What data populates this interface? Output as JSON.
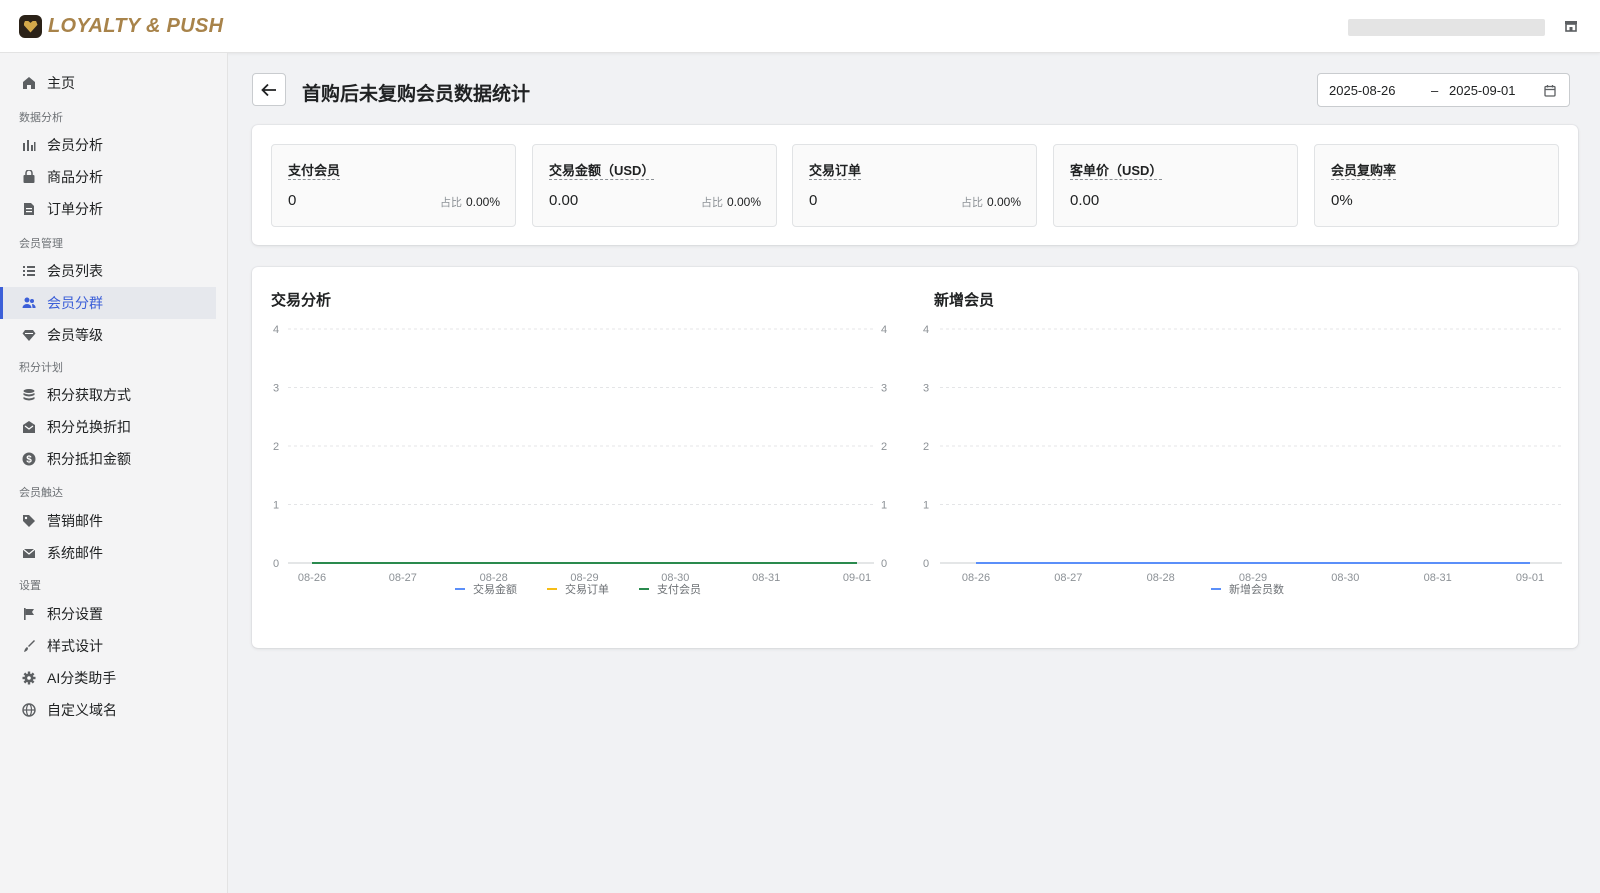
{
  "brand": {
    "name": "LOYALTY & PUSH"
  },
  "colors": {
    "accent": "#3c5fd8",
    "brand_gold": "#a8834a",
    "series_amount": "#5b8ff9",
    "series_orders": "#f6bd16",
    "series_members": "#2a8a4e",
    "series_new_members": "#5b8ff9"
  },
  "sidebar": {
    "home": {
      "label": "主页",
      "icon": "home-icon"
    },
    "groups": [
      {
        "title": "数据分析",
        "items": [
          {
            "label": "会员分析",
            "icon": "bar-chart-icon"
          },
          {
            "label": "商品分析",
            "icon": "bag-icon"
          },
          {
            "label": "订单分析",
            "icon": "document-icon"
          }
        ]
      },
      {
        "title": "会员管理",
        "items": [
          {
            "label": "会员列表",
            "icon": "list-icon"
          },
          {
            "label": "会员分群",
            "icon": "users-icon",
            "active": true
          },
          {
            "label": "会员等级",
            "icon": "diamond-icon"
          }
        ]
      },
      {
        "title": "积分计划",
        "items": [
          {
            "label": "积分获取方式",
            "icon": "database-icon"
          },
          {
            "label": "积分兑换折扣",
            "icon": "discount-mail-icon"
          },
          {
            "label": "积分抵扣金额",
            "icon": "dollar-icon"
          }
        ]
      },
      {
        "title": "会员触达",
        "items": [
          {
            "label": "营销邮件",
            "icon": "tag-icon"
          },
          {
            "label": "系统邮件",
            "icon": "mail-icon"
          }
        ]
      },
      {
        "title": "设置",
        "items": [
          {
            "label": "积分设置",
            "icon": "flag-icon"
          },
          {
            "label": "样式设计",
            "icon": "brush-icon"
          },
          {
            "label": "AI分类助手",
            "icon": "gear-icon"
          },
          {
            "label": "自定义域名",
            "icon": "globe-icon"
          }
        ]
      }
    ]
  },
  "page": {
    "title": "首购后未复购会员数据统计",
    "date_start": "2025-08-26",
    "date_sep": "–",
    "date_end": "2025-09-01"
  },
  "stats": [
    {
      "label": "支付会员",
      "value": "0",
      "share_prefix": "占比",
      "share": "0.00%"
    },
    {
      "label": "交易金额（USD）",
      "value": "0.00",
      "share_prefix": "占比",
      "share": "0.00%"
    },
    {
      "label": "交易订单",
      "value": "0",
      "share_prefix": "占比",
      "share": "0.00%"
    },
    {
      "label": "客单价（USD）",
      "value": "0.00"
    },
    {
      "label": "会员复购率",
      "value": "0%"
    }
  ],
  "chart_data": [
    {
      "type": "line",
      "title": "交易分析",
      "x": [
        "08-26",
        "08-27",
        "08-28",
        "08-29",
        "08-30",
        "08-31",
        "09-01"
      ],
      "ylim": [
        0,
        4
      ],
      "y_ticks": [
        "0",
        "1",
        "2",
        "3",
        "4"
      ],
      "y2_ticks": [
        "0",
        "1",
        "2",
        "3",
        "4"
      ],
      "grid": true,
      "legend": "bottom",
      "series": [
        {
          "name": "交易金额",
          "values": [
            0,
            0,
            0,
            0,
            0,
            0,
            0
          ],
          "color": "#5b8ff9"
        },
        {
          "name": "交易订单",
          "values": [
            0,
            0,
            0,
            0,
            0,
            0,
            0
          ],
          "color": "#f6bd16"
        },
        {
          "name": "支付会员",
          "values": [
            0,
            0,
            0,
            0,
            0,
            0,
            0
          ],
          "color": "#2a8a4e"
        }
      ]
    },
    {
      "type": "line",
      "title": "新增会员",
      "x": [
        "08-26",
        "08-27",
        "08-28",
        "08-29",
        "08-30",
        "08-31",
        "09-01"
      ],
      "ylim": [
        0,
        4
      ],
      "y_ticks": [
        "0",
        "1",
        "2",
        "3",
        "4"
      ],
      "grid": true,
      "legend": "bottom",
      "series": [
        {
          "name": "新增会员数",
          "values": [
            0,
            0,
            0,
            0,
            0,
            0,
            0
          ],
          "color": "#5b8ff9"
        }
      ]
    }
  ]
}
